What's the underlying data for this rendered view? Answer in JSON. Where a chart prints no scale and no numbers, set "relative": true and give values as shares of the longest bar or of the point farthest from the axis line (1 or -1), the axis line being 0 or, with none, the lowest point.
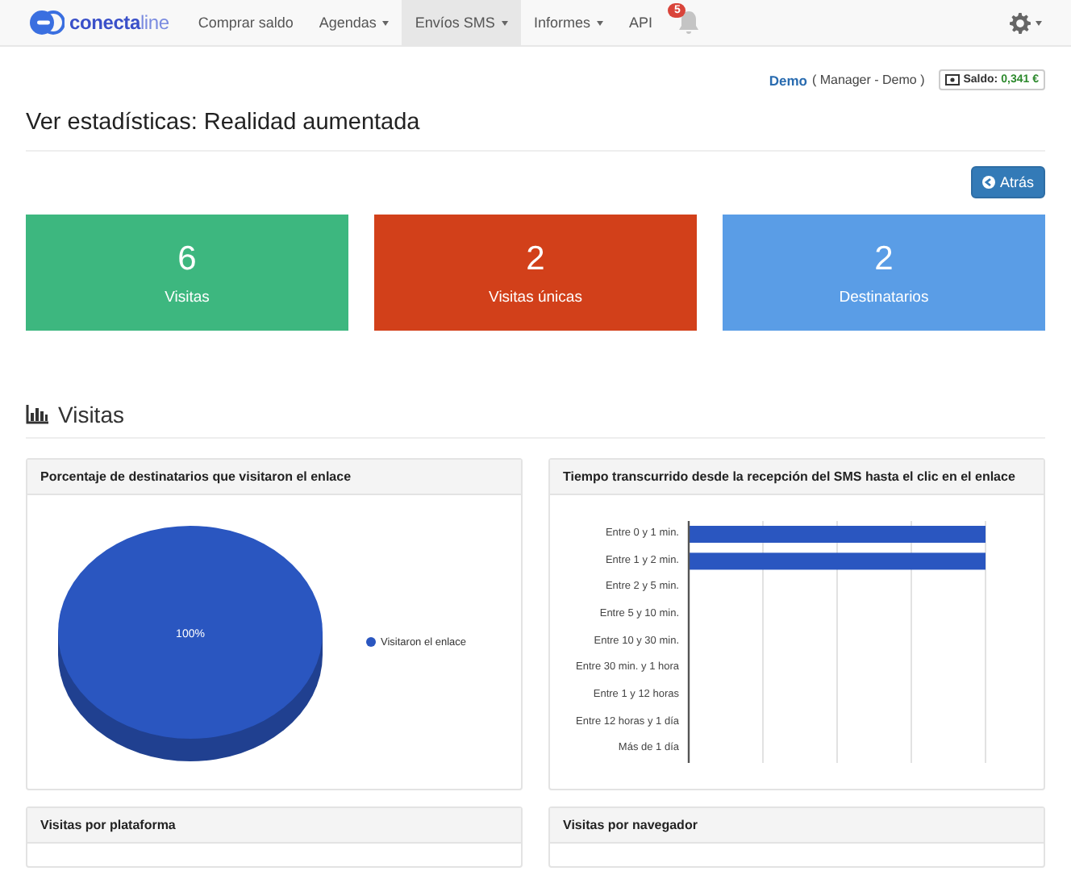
{
  "navbar": {
    "brand": {
      "name": "conecta",
      "suffix": "line"
    },
    "items": [
      {
        "label": "Comprar saldo",
        "dropdown": false,
        "selected": false
      },
      {
        "label": "Agendas",
        "dropdown": true,
        "selected": false
      },
      {
        "label": "Envíos SMS",
        "dropdown": true,
        "selected": true
      },
      {
        "label": "Informes",
        "dropdown": true,
        "selected": false
      },
      {
        "label": "API",
        "dropdown": false,
        "selected": false
      }
    ],
    "notifications": {
      "count": "5"
    }
  },
  "account": {
    "user": "Demo",
    "role": "( Manager - Demo )",
    "balance_label": "Saldo:",
    "balance": "0,341 €"
  },
  "page_title": "Ver estadísticas: Realidad aumentada",
  "back_button": "Atrás",
  "stats": [
    {
      "value": "6",
      "label": "Visitas",
      "color": "#3db77f"
    },
    {
      "value": "2",
      "label": "Visitas únicas",
      "color": "#d2401a"
    },
    {
      "value": "2",
      "label": "Destinatarios",
      "color": "#5a9de6"
    }
  ],
  "section_title": "Visitas",
  "panels": [
    {
      "title": "Porcentaje de destinatarios que visitaron el enlace",
      "chart_data": {
        "type": "pie",
        "categories": [
          "Visitaron el enlace"
        ],
        "values": [
          100
        ],
        "colors": [
          "#2a56c0"
        ],
        "data_labels": true,
        "value_labels": [
          "100%"
        ]
      }
    },
    {
      "title": "Tiempo transcurrido desde la recepción del SMS hasta el clic en el enlace",
      "chart_data": {
        "type": "bar",
        "orientation": "horizontal",
        "relative": true,
        "categories": [
          "Entre 0 y 1 min.",
          "Entre 1 y 2 min.",
          "Entre 2 y 5 min.",
          "Entre 5 y 10 min.",
          "Entre 10 y 30 min.",
          "Entre 30 min. y 1 hora",
          "Entre 1 y 12 horas",
          "Entre 12 horas y 1 día",
          "Más de 1 día"
        ],
        "values": [
          1,
          1,
          0,
          0,
          0,
          0,
          0,
          0,
          0
        ],
        "color": "#2a56c0"
      }
    },
    {
      "title": "Visitas por plataforma"
    },
    {
      "title": "Visitas por navegador"
    }
  ]
}
